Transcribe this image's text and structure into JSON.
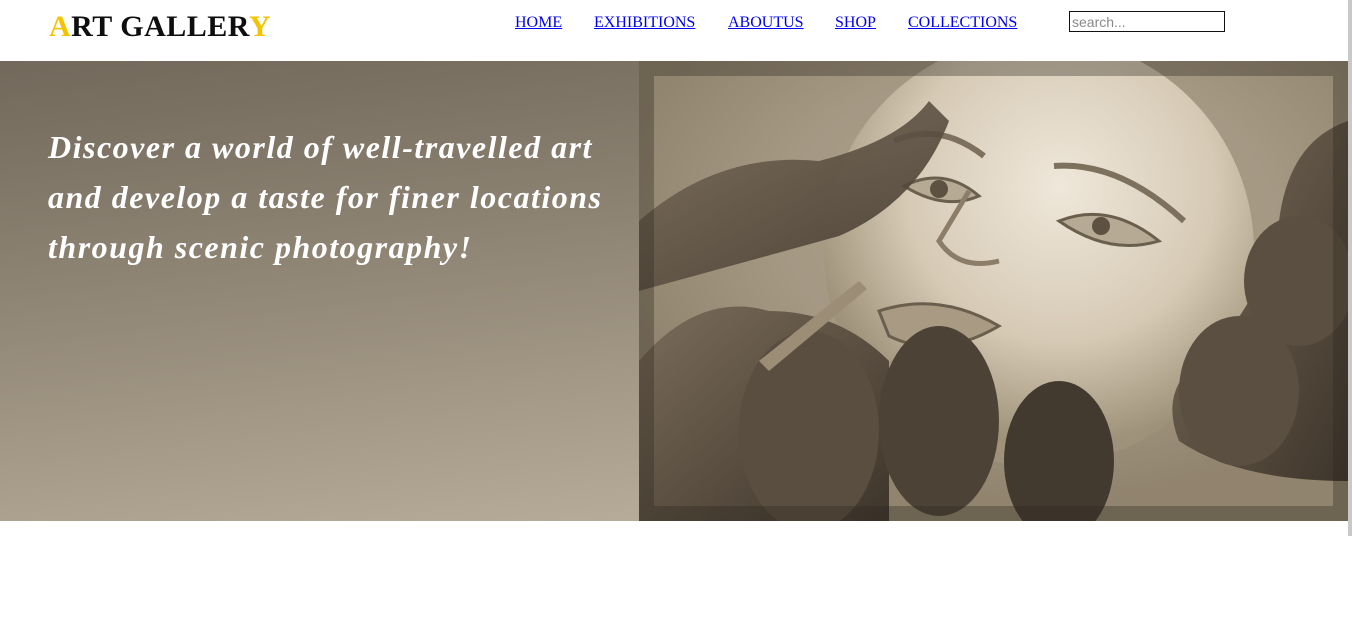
{
  "logo": {
    "first_letter": "A",
    "middle": "RT GALLER",
    "last_letter": "Y",
    "accent_color": "#f5c400"
  },
  "nav": {
    "items": [
      {
        "label": "HOME"
      },
      {
        "label": "EXHIBITIONS"
      },
      {
        "label": "ABOUTUS"
      },
      {
        "label": "SHOP"
      },
      {
        "label": "COLLECTIONS"
      }
    ]
  },
  "search": {
    "placeholder": "search...",
    "value": ""
  },
  "hero": {
    "tagline_line1": "Discover a world of well-travelled art",
    "tagline_line2": "and develop a taste for finer locations",
    "tagline_line3": "through scenic photography!",
    "image_subject": "sepia photograph of hands sculpting a clay face"
  },
  "colors": {
    "link": "#0000ee",
    "logo_text": "#0e0e0e",
    "hero_left_top": "#72685b",
    "hero_left_bottom": "#b6ab98"
  }
}
